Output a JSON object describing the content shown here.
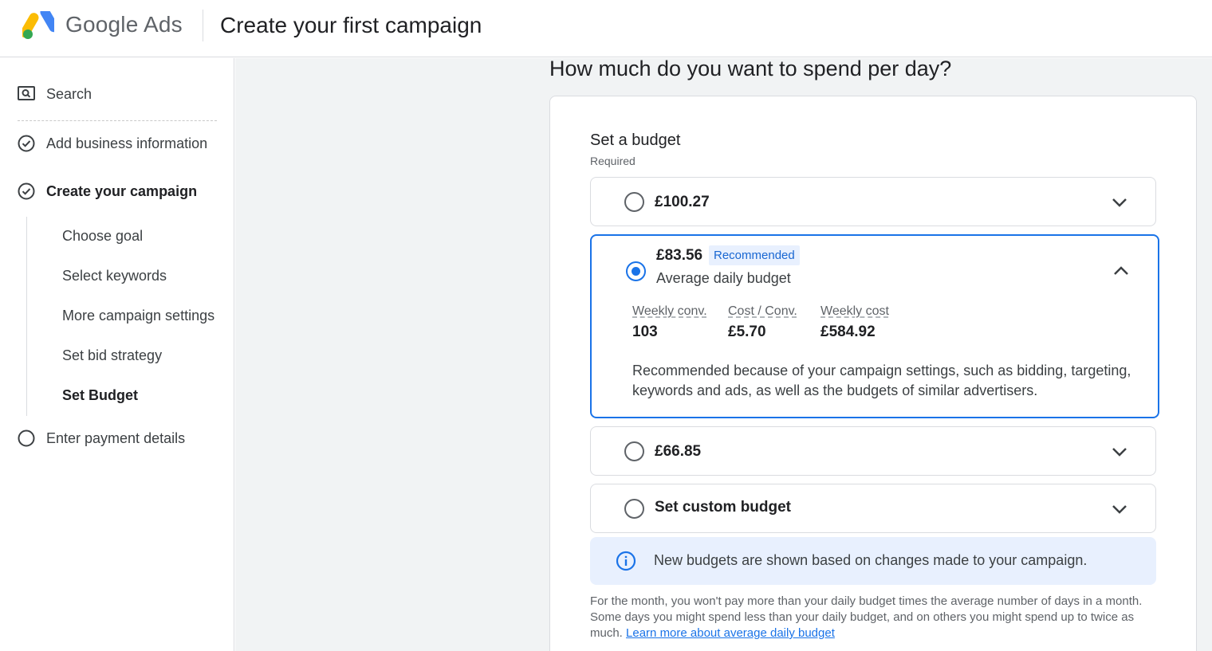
{
  "header": {
    "logo_google": "Google",
    "logo_ads": "Ads",
    "title": "Create your first campaign"
  },
  "sidebar": {
    "search_label": "Search",
    "items": [
      {
        "label": "Add business information",
        "state": "done"
      },
      {
        "label": "Create your campaign",
        "state": "current"
      },
      {
        "label": "Enter payment details",
        "state": "todo"
      }
    ],
    "sub_items": [
      {
        "label": "Choose goal"
      },
      {
        "label": "Select keywords"
      },
      {
        "label": "More campaign settings"
      },
      {
        "label": "Set bid strategy"
      },
      {
        "label": "Set Budget",
        "active": true
      }
    ]
  },
  "main": {
    "question": "How much do you want to spend per day?",
    "budget": {
      "title": "Set a budget",
      "required": "Required",
      "options": [
        {
          "amount": "£100.27",
          "selected": false,
          "expanded": false
        },
        {
          "amount": "£83.56",
          "badge": "Recommended",
          "subtitle": "Average daily budget",
          "selected": true,
          "expanded": true,
          "stats": [
            {
              "label": "Weekly conv.",
              "value": "103"
            },
            {
              "label": "Cost / Conv.",
              "value": "£5.70"
            },
            {
              "label": "Weekly cost",
              "value": "£584.92"
            }
          ],
          "reason": "Recommended because of your campaign settings, such as bidding, targeting, keywords and ads, as well as the budgets of similar advertisers."
        },
        {
          "amount": "£66.85",
          "selected": false,
          "expanded": false
        },
        {
          "amount": "Set custom budget",
          "selected": false,
          "expanded": false
        }
      ],
      "info": "New budgets are shown based on changes made to your campaign.",
      "footnote": "For the month, you won't pay more than your daily budget times the average number of days in a month. Some days you might spend less than your daily budget, and on others you might spend up to twice as much.",
      "learn_more": "Learn more about average daily budget"
    }
  },
  "colors": {
    "accent": "#1a73e8",
    "badge_bg": "#e8f0fe",
    "main_bg": "#f1f3f4"
  },
  "icons": {
    "logo": "google-ads-logo",
    "search": "search-icon",
    "check": "check-circle-icon",
    "empty": "empty-circle-icon",
    "chevron_down": "chevron-down-icon",
    "chevron_up": "chevron-up-icon",
    "info": "info-icon"
  }
}
